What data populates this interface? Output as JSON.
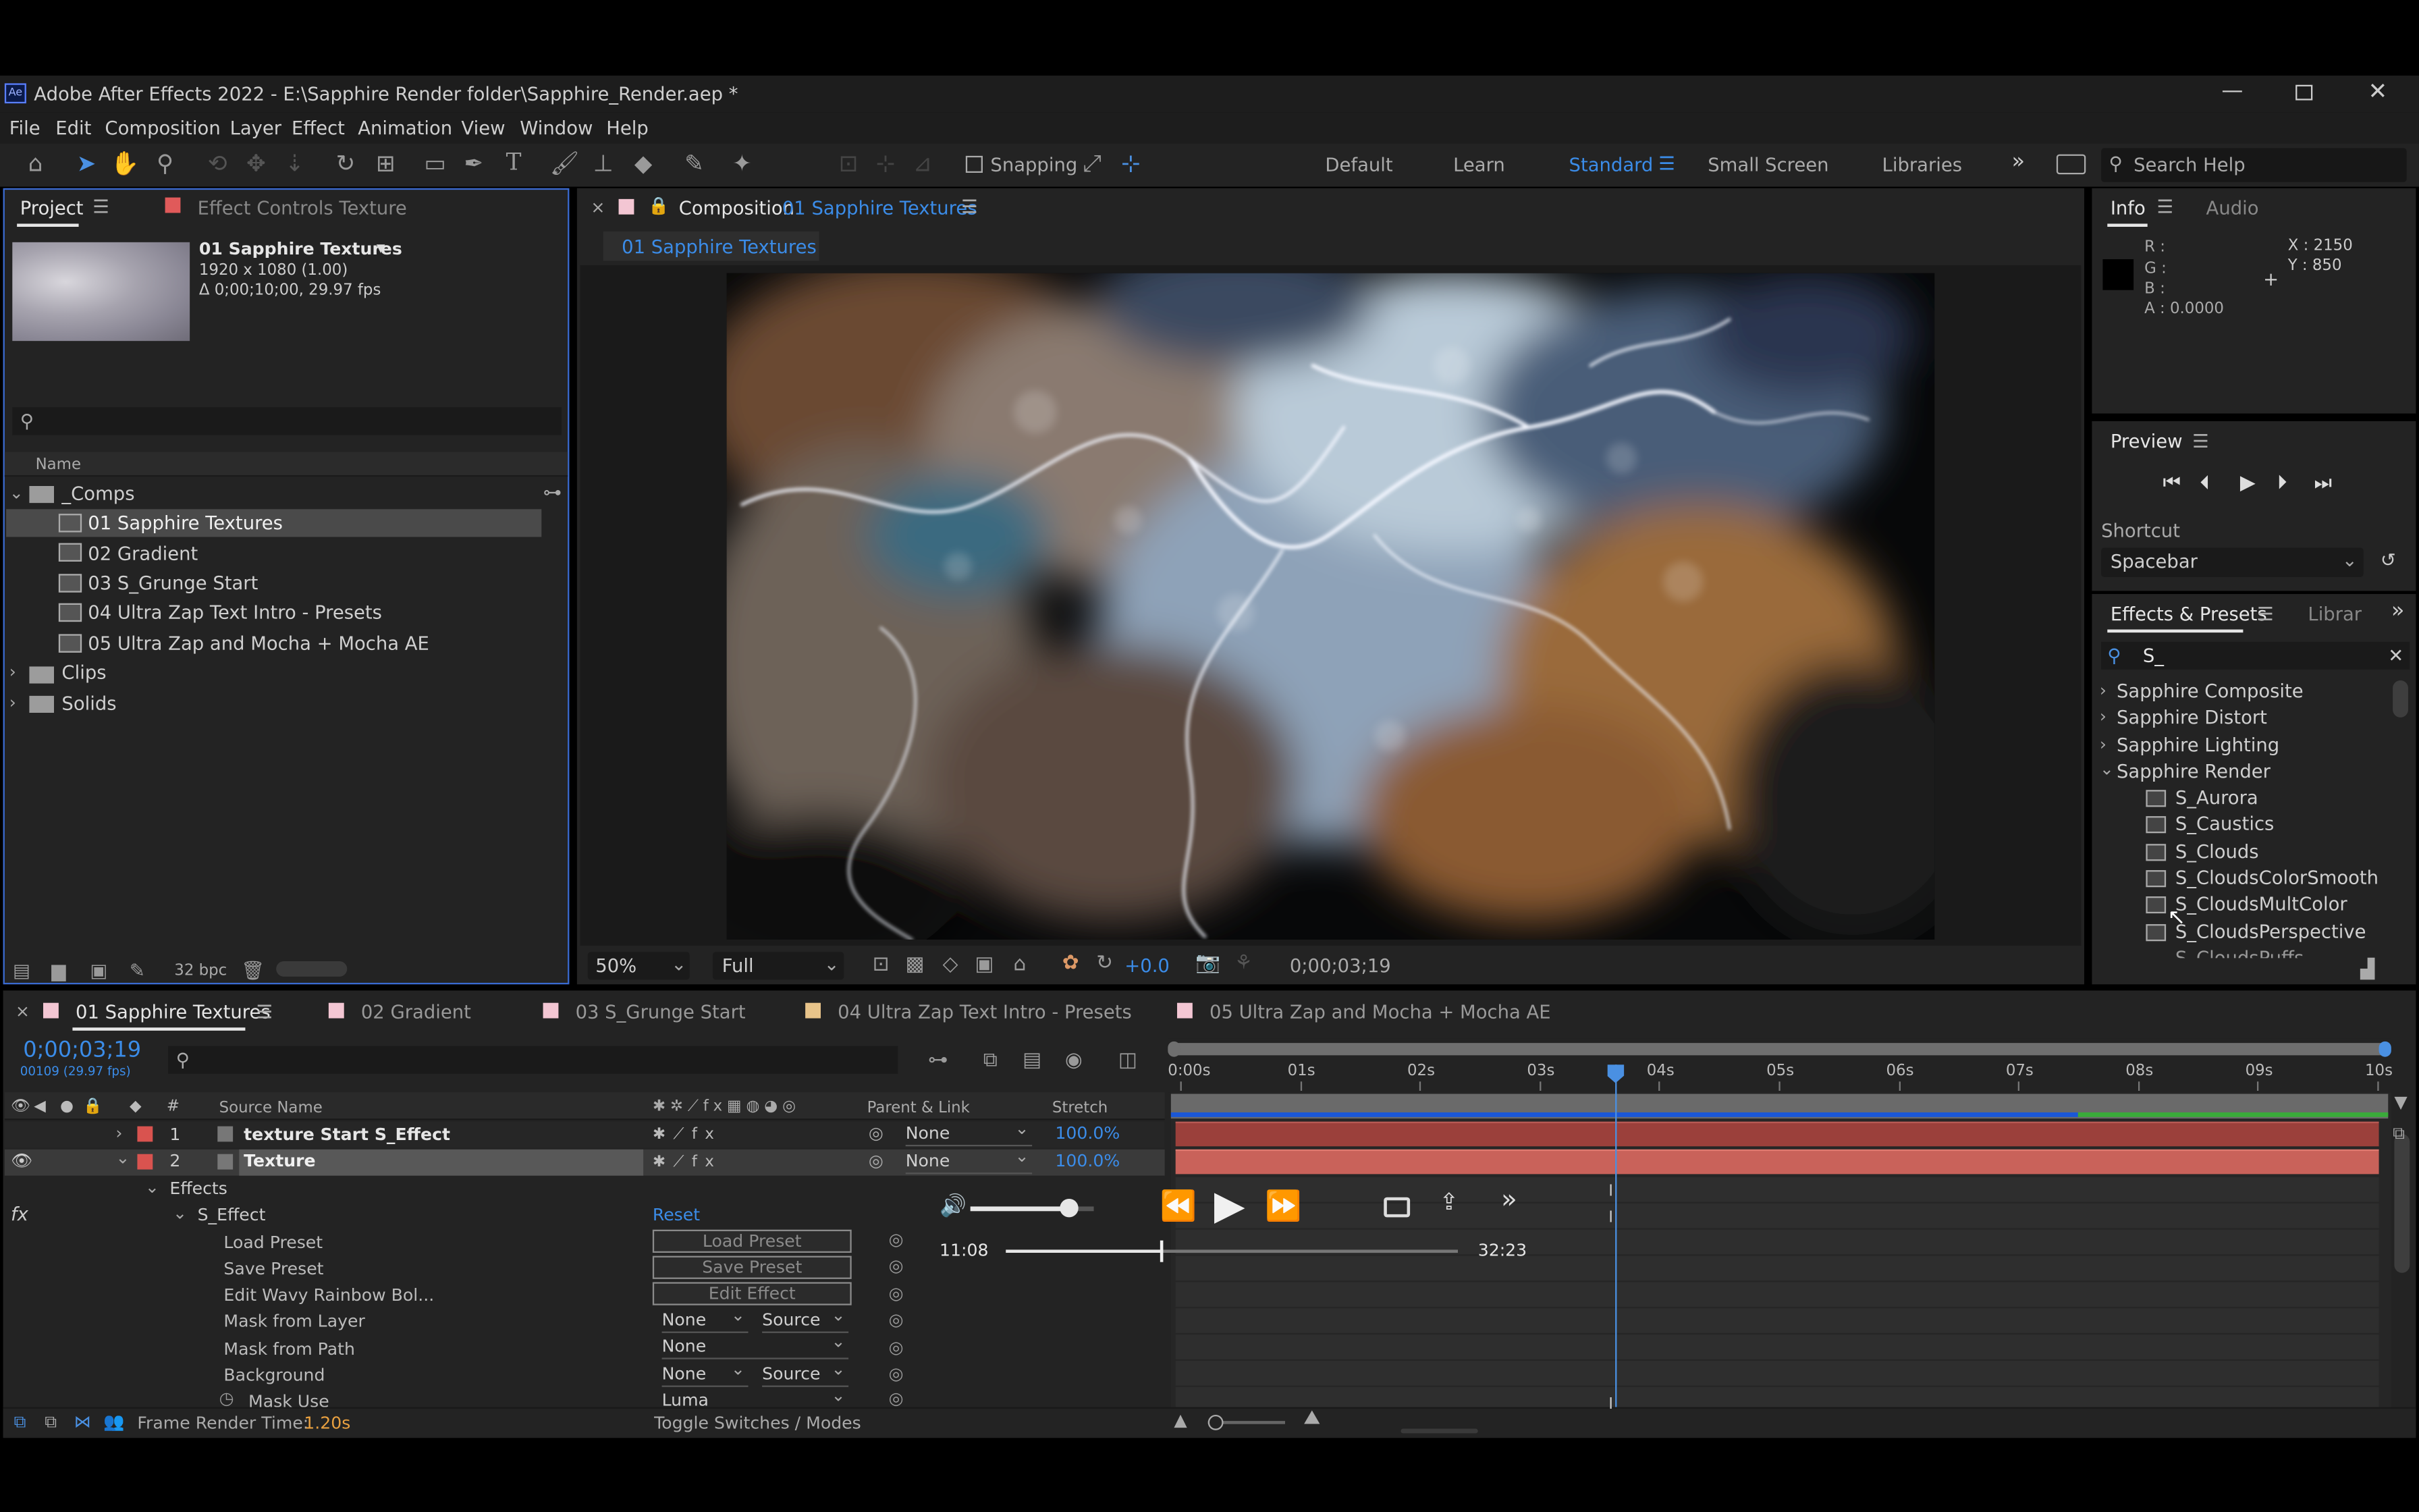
{
  "window": {
    "title": "Adobe After Effects 2022 - E:\\Sapphire Render folder\\Sapphire_Render.aep *",
    "app_icon": "Ae"
  },
  "menu": [
    "File",
    "Edit",
    "Composition",
    "Layer",
    "Effect",
    "Animation",
    "View",
    "Window",
    "Help"
  ],
  "toolbar": {
    "snapping": "Snapping",
    "workspaces": [
      "Default",
      "Learn",
      "Standard",
      "Small Screen",
      "Libraries"
    ],
    "active_workspace": "Standard",
    "search_placeholder": "Search Help"
  },
  "project": {
    "tab": "Project",
    "effect_tab": "Effect Controls Texture",
    "comp_name": "01 Sapphire Textures",
    "comp_size": "1920 x 1080 (1.00)",
    "comp_dur": "Δ 0;00;10;00, 29.97 fps",
    "col_name": "Name",
    "tree": [
      {
        "label": "_Comps",
        "type": "folder",
        "open": true
      },
      {
        "label": "01 Sapphire Textures",
        "type": "comp",
        "selected": true
      },
      {
        "label": "02 Gradient",
        "type": "comp"
      },
      {
        "label": "03 S_Grunge Start",
        "type": "comp"
      },
      {
        "label": "04 Ultra Zap Text Intro - Presets",
        "type": "comp"
      },
      {
        "label": "05 Ultra Zap and Mocha + Mocha AE",
        "type": "comp"
      },
      {
        "label": "Clips",
        "type": "folder"
      },
      {
        "label": "Solids",
        "type": "folder"
      }
    ],
    "bpc": "32 bpc"
  },
  "composition": {
    "tab_prefix": "Composition",
    "tab_name": "01 Sapphire Textures",
    "sub_tab": "01 Sapphire Textures",
    "zoom": "50%",
    "quality": "Full",
    "exposure": "+0.0",
    "timecode": "0;00;03;19"
  },
  "info": {
    "tab": "Info",
    "tab2": "Audio",
    "r": "R :",
    "g": "G :",
    "b": "B :",
    "a": "A :  0.0000",
    "x": "X : 2150",
    "y": "Y : 850"
  },
  "preview": {
    "title": "Preview",
    "shortcut_label": "Shortcut",
    "shortcut": "Spacebar"
  },
  "effects": {
    "tab": "Effects & Presets",
    "tab2": "Librar",
    "search": "S_",
    "items": [
      {
        "label": "Sapphire Composite",
        "folder": true
      },
      {
        "label": "Sapphire Distort",
        "folder": true
      },
      {
        "label": "Sapphire Lighting",
        "folder": true
      },
      {
        "label": "Sapphire Render",
        "folder": true,
        "open": true
      },
      {
        "label": "S_Aurora"
      },
      {
        "label": "S_Caustics"
      },
      {
        "label": "S_Clouds"
      },
      {
        "label": "S_CloudsColorSmooth"
      },
      {
        "label": "S_CloudsMultColor"
      },
      {
        "label": "S_CloudsPerspective"
      },
      {
        "label": "S_CloudsPuffs"
      }
    ]
  },
  "timeline": {
    "tabs": [
      "01 Sapphire Textures",
      "02 Gradient",
      "03 S_Grunge Start",
      "04 Ultra Zap Text Intro - Presets",
      "05 Ultra Zap and Mocha + Mocha AE"
    ],
    "tab_colors": [
      "#f3c6d3",
      "#f3c6d3",
      "#f3c6d3",
      "#e8c48a",
      "#f3c6d3"
    ],
    "timecode": "0;00;03;19",
    "frame": "00109 (29.97 fps)",
    "ruler": [
      "0:00s",
      "01s",
      "02s",
      "03s",
      "04s",
      "05s",
      "06s",
      "07s",
      "08s",
      "09s",
      "10s"
    ],
    "playhead_seconds": 3.63,
    "col_source": "Source Name",
    "col_parent": "Parent & Link",
    "col_stretch": "Stretch",
    "layers": [
      {
        "num": "1",
        "name": "texture Start S_Effect",
        "parent": "None",
        "stretch": "100.0%"
      },
      {
        "num": "2",
        "name": "Texture",
        "parent": "None",
        "stretch": "100.0%",
        "selected": true
      }
    ],
    "effects_label": "Effects",
    "effect_name": "S_Effect",
    "reset": "Reset",
    "props": [
      {
        "label": "Load Preset",
        "button": "Load Preset"
      },
      {
        "label": "Save Preset",
        "button": "Save Preset"
      },
      {
        "label": "Edit Wavy Rainbow Bol...",
        "button": "Edit Effect"
      },
      {
        "label": "Mask from Layer",
        "dd1": "None",
        "dd2": "Source"
      },
      {
        "label": "Mask from Path",
        "dd1": "None"
      },
      {
        "label": "Background",
        "dd1": "None",
        "dd2": "Source"
      },
      {
        "label": "Mask Use",
        "dd1": "Luma"
      }
    ],
    "render_time_label": "Frame Render Time:",
    "render_time": "1.20s",
    "toggle": "Toggle Switches / Modes"
  },
  "player": {
    "current": "11:08",
    "total": "32:23",
    "progress": 0.344,
    "volume": 0.8
  }
}
